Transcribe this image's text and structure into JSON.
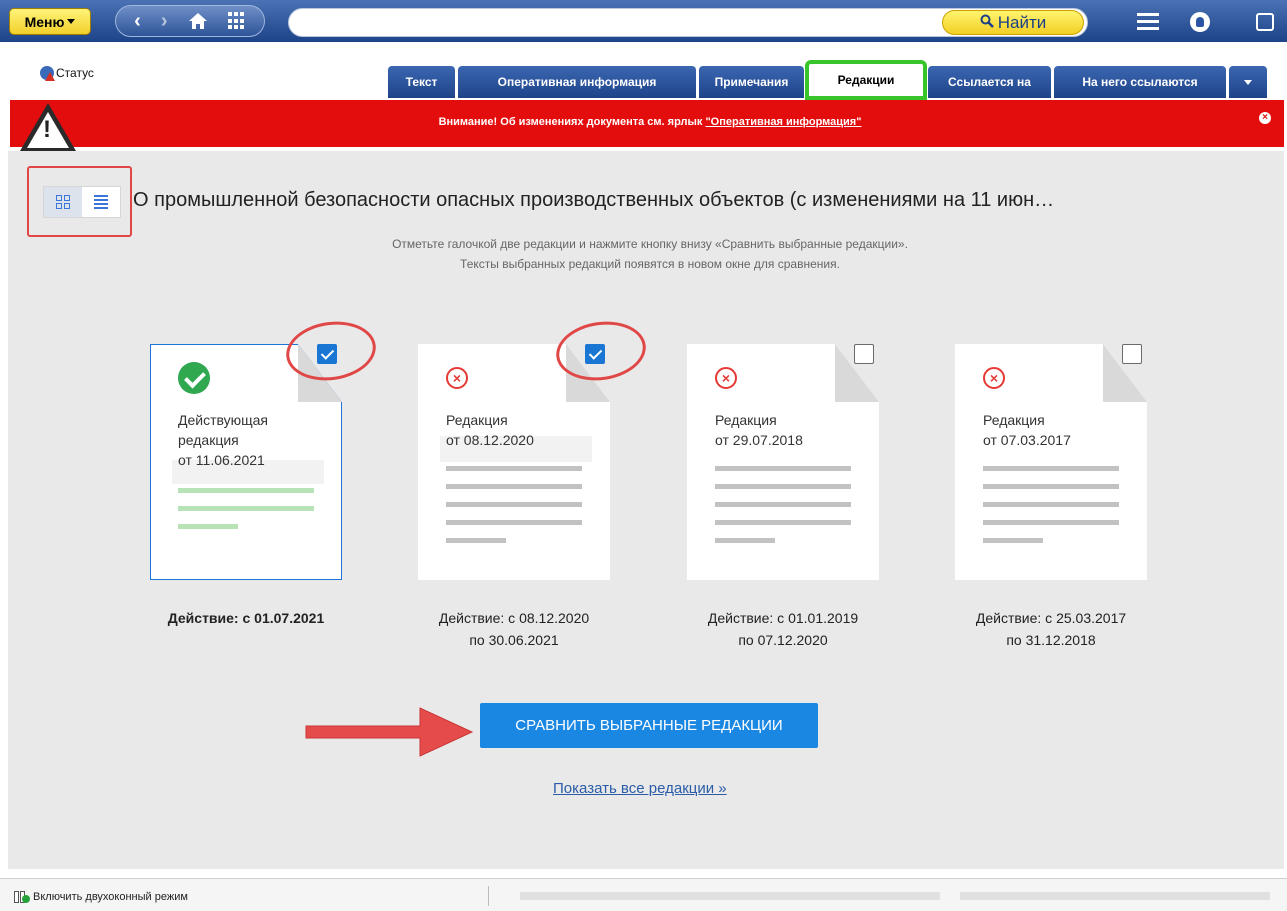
{
  "toolbar": {
    "menu_label": "Меню",
    "find_label": "Найти",
    "search_value": ""
  },
  "status_label": "Статус",
  "tabs": [
    {
      "label": "Текст",
      "active": false
    },
    {
      "label": "Оперативная информация",
      "active": false
    },
    {
      "label": "Примечания",
      "active": false
    },
    {
      "label": "Редакции",
      "active": true
    },
    {
      "label": "Ссылается на",
      "active": false
    },
    {
      "label": "На него ссылаются",
      "active": false
    }
  ],
  "alert": {
    "text": "Внимание! Об изменениях документа см. ярлык ",
    "link": "\"Оперативная информация\"",
    "close": "×"
  },
  "document": {
    "title": "О промышленной безопасности опасных производственных объектов (с изменениями на 11 июн…",
    "hint_line1": "Отметьте галочкой две редакции и нажмите кнопку внизу «Сравнить выбранные редакции».",
    "hint_line2": "Тексты выбранных редакций появятся в новом окне для сравнения."
  },
  "editions": [
    {
      "line1": "Действующая",
      "line2": "редакция",
      "line3": "от 11.06.2021",
      "checked": true,
      "status": "current",
      "validity1": "Действие: с 01.07.2021",
      "validity2": ""
    },
    {
      "line1": "Редакция",
      "line2": "от 08.12.2020",
      "line3": "",
      "checked": true,
      "status": "expired",
      "validity1": "Действие: с 08.12.2020",
      "validity2": "по 30.06.2021"
    },
    {
      "line1": "Редакция",
      "line2": "от 29.07.2018",
      "line3": "",
      "checked": false,
      "status": "expired",
      "validity1": "Действие: с 01.01.2019",
      "validity2": "по 07.12.2020"
    },
    {
      "line1": "Редакция",
      "line2": "от 07.03.2017",
      "line3": "",
      "checked": false,
      "status": "expired",
      "validity1": "Действие: с 25.03.2017",
      "validity2": "по 31.12.2018"
    }
  ],
  "compare_button": "СРАВНИТЬ ВЫБРАННЫЕ РЕДАКЦИИ",
  "show_all_link": "Показать все редакции »",
  "footer": {
    "dual_mode": "Включить двухоконный режим"
  },
  "colors": {
    "accent": "#1a87e3",
    "alert": "#e30d0d",
    "active_tab_outline": "#38c52c",
    "annotation": "#e04848"
  }
}
